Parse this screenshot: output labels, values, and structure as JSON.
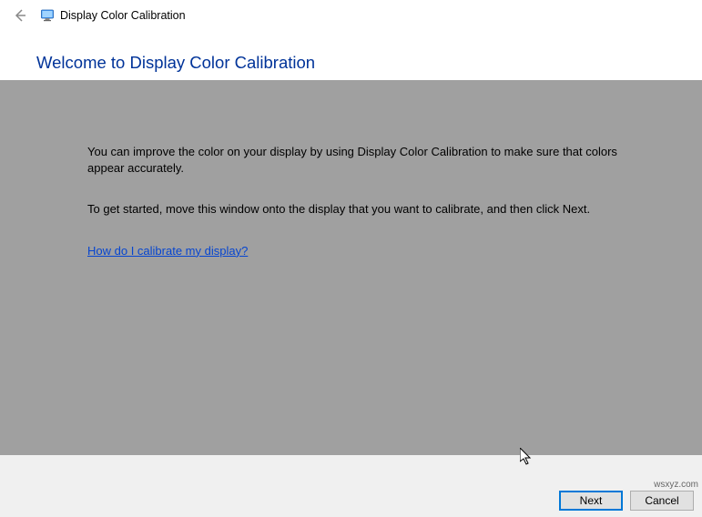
{
  "header": {
    "title": "Display Color Calibration"
  },
  "heading": "Welcome to Display Color Calibration",
  "content": {
    "para1": "You can improve the color on your display by using Display Color Calibration to make sure that colors appear accurately.",
    "para2": "To get started, move this window onto the display that you want to calibrate, and then click Next.",
    "help_link": "How do I calibrate my display?"
  },
  "footer": {
    "next_label": "Next",
    "cancel_label": "Cancel"
  },
  "watermark": "wsxyz.com"
}
